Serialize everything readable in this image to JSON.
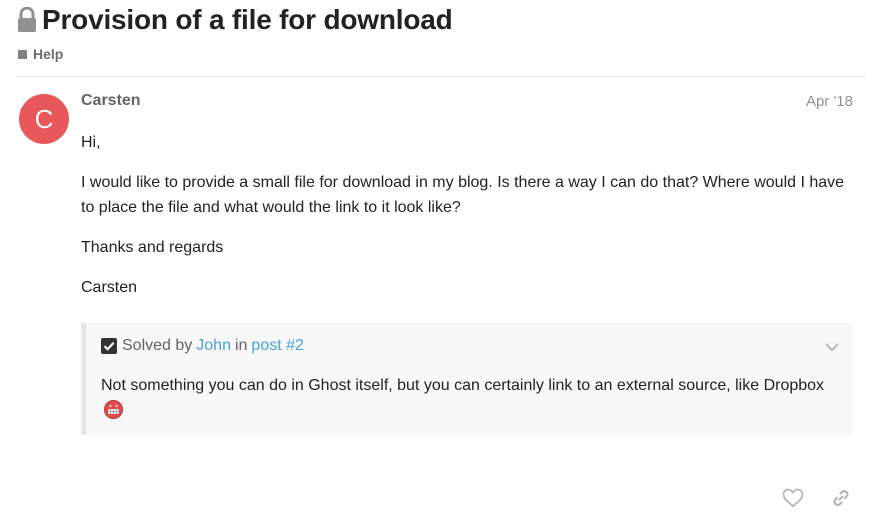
{
  "topic": {
    "title": "Provision of a file for download",
    "category": "Help",
    "category_color": "#808281"
  },
  "post": {
    "avatar_letter": "C",
    "avatar_color": "#e8575a",
    "username": "Carsten",
    "date": "Apr '18",
    "paragraphs": [
      "Hi,",
      "I would like to provide a small file for download in my blog. Is there a way I can do that? Where would I have to place the file and what would the link to it look like?",
      "Thanks and regards",
      "Carsten"
    ]
  },
  "solution": {
    "solved_by_label": "Solved by",
    "author": "John",
    "in_word": "in",
    "post_ref": "post #2",
    "excerpt": "Not something you can do in Ghost itself, but you can certainly link to an external source, like Dropbox",
    "link_color": "#4aa3df"
  },
  "actions": {
    "like_icon": "heart-icon",
    "share_icon": "link-icon"
  }
}
